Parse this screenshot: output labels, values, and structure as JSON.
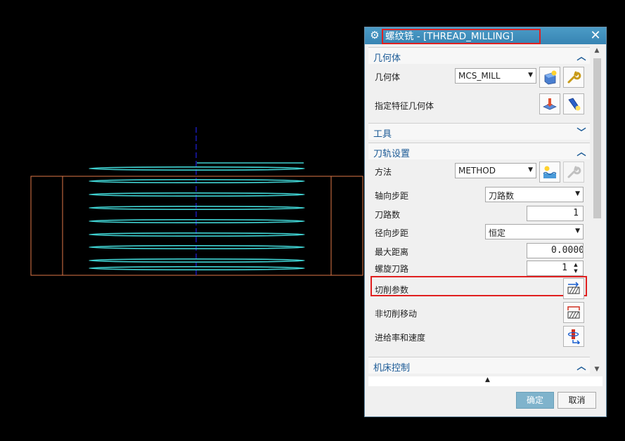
{
  "dialog": {
    "title": "螺纹铣 - [THREAD_MILLING]",
    "sections": {
      "geometry": {
        "title": "几何体",
        "geometry_label": "几何体",
        "geometry_value": "MCS_MILL",
        "feature_label": "指定特征几何体"
      },
      "tool": {
        "title": "工具"
      },
      "path_settings": {
        "title": "刀轨设置",
        "method_label": "方法",
        "method_value": "METHOD",
        "axial_step_label": "轴向步距",
        "axial_step_value": "刀路数",
        "pass_count_label": "刀路数",
        "pass_count_value": "1",
        "radial_step_label": "径向步距",
        "radial_step_value": "恒定",
        "max_distance_label": "最大距离",
        "max_distance_value": "0.0000",
        "spiral_passes_label": "螺旋刀路",
        "spiral_passes_value": "1",
        "cut_params_label": "切削参数",
        "noncut_moves_label": "非切削移动",
        "feeds_speeds_label": "进给率和速度"
      },
      "machine_control": {
        "title": "机床控制"
      }
    },
    "buttons": {
      "ok": "确定",
      "cancel": "取消"
    }
  },
  "colors": {
    "title_bar": "#3c8dbc",
    "section_title": "#1b5a96",
    "highlight": "#e02020",
    "thread_path": "#3fd0d0",
    "part_outline": "#e07848",
    "axis": "#2020e0"
  },
  "icons": {
    "title": "gear-icon",
    "close": "close-icon",
    "geometry_new": "new-geometry-icon",
    "geometry_edit": "wrench-icon",
    "feature_select": "select-feature-icon",
    "feature_display": "flashlight-icon",
    "method_new": "new-method-icon",
    "method_edit": "wrench-icon",
    "cut_params": "cut-parameters-icon",
    "noncut_moves": "non-cutting-moves-icon",
    "feeds_speeds": "feeds-speeds-icon"
  }
}
